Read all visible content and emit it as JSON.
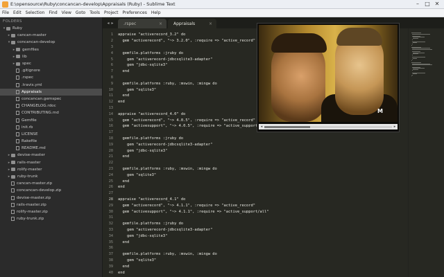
{
  "window": {
    "title": "E:\\opensource\\Ruby\\concancan-develop\\Appraisals (Ruby) - Sublime Text",
    "controls": [
      "–",
      "□",
      "✕"
    ]
  },
  "menu": [
    "File",
    "Edit",
    "Selection",
    "Find",
    "View",
    "Goto",
    "Tools",
    "Project",
    "Preferences",
    "Help"
  ],
  "sidebar": {
    "header": "FOLDERS",
    "items": [
      {
        "label": "Ruby",
        "indent": 0,
        "type": "folder",
        "expanded": true
      },
      {
        "label": "cancan-master",
        "indent": 1,
        "type": "folder",
        "expanded": false
      },
      {
        "label": "concancan-develop",
        "indent": 1,
        "type": "folder",
        "expanded": true
      },
      {
        "label": "gemfiles",
        "indent": 2,
        "type": "folder",
        "expanded": false
      },
      {
        "label": "lib",
        "indent": 2,
        "type": "folder",
        "expanded": false
      },
      {
        "label": "spec",
        "indent": 2,
        "type": "folder",
        "expanded": false
      },
      {
        "label": ".gitignore",
        "indent": 2,
        "type": "file"
      },
      {
        "label": ".rspec",
        "indent": 2,
        "type": "file"
      },
      {
        "label": ".travis.yml",
        "indent": 2,
        "type": "file"
      },
      {
        "label": "Appraisals",
        "indent": 2,
        "type": "file",
        "selected": true
      },
      {
        "label": "concancan.gemspec",
        "indent": 2,
        "type": "file"
      },
      {
        "label": "CHANGELOG.rdoc",
        "indent": 2,
        "type": "file"
      },
      {
        "label": "CONTRIBUTING.md",
        "indent": 2,
        "type": "file"
      },
      {
        "label": "Gemfile",
        "indent": 2,
        "type": "file"
      },
      {
        "label": "init.rb",
        "indent": 2,
        "type": "file"
      },
      {
        "label": "LICENSE",
        "indent": 2,
        "type": "file"
      },
      {
        "label": "Rakefile",
        "indent": 2,
        "type": "file"
      },
      {
        "label": "README.md",
        "indent": 2,
        "type": "file"
      },
      {
        "label": "devise-master",
        "indent": 1,
        "type": "folder",
        "expanded": false
      },
      {
        "label": "rails-master",
        "indent": 1,
        "type": "folder",
        "expanded": false
      },
      {
        "label": "rolify-master",
        "indent": 1,
        "type": "folder",
        "expanded": false
      },
      {
        "label": "ruby-trunk",
        "indent": 1,
        "type": "folder",
        "expanded": false
      },
      {
        "label": "cancan-master.zip",
        "indent": 1,
        "type": "file"
      },
      {
        "label": "concancan-develop.zip",
        "indent": 1,
        "type": "file"
      },
      {
        "label": "devise-master.zip",
        "indent": 1,
        "type": "file"
      },
      {
        "label": "rails-master.zip",
        "indent": 1,
        "type": "file"
      },
      {
        "label": "rolify-master.zip",
        "indent": 1,
        "type": "file"
      },
      {
        "label": "ruby-trunk.zip",
        "indent": 1,
        "type": "file"
      }
    ]
  },
  "tabs": [
    {
      "label": ".rspec",
      "active": false
    },
    {
      "label": "Appraisals",
      "active": true
    }
  ],
  "tab_close_glyph": "×",
  "editor": {
    "highlight_line": 28,
    "lines": [
      "appraise \"activerecord_3.2\" do",
      "  gem \"activerecord\", \"~> 3.2.0\", :require => \"active_record\"",
      "",
      "  gemfile.platforms :jruby do",
      "    gem \"activerecord-jdbcsqlite3-adapter\"",
      "    gem \"jdbc-sqlite3\"",
      "  end",
      "",
      "  gemfile.platforms :ruby, :mswin, :mingw do",
      "    gem \"sqlite3\"",
      "  end",
      "end",
      "",
      "appraise \"activerecord_4.0\" do",
      "  gem \"activerecord\", \"~> 4.0.5\", :require => \"active_record\"",
      "  gem \"activesupport\", \"~> 4.0.5\", :require => \"active_support/all\"",
      "",
      "  gemfile.platforms :jruby do",
      "    gem \"activerecord-jdbcsqlite3-adapter\"",
      "    gem \"jdbc-sqlite3\"",
      "  end",
      "",
      "  gemfile.platforms :ruby, :mswin, :mingw do",
      "    gem \"sqlite3\"",
      "  end",
      "end",
      "",
      "appraise \"activerecord_4.1\" do",
      "  gem \"activerecord\", \"~> 4.1.1\", :require => \"active_record\"",
      "  gem \"activesupport\", \"~> 4.1.1\", :require => \"active_support/all\"",
      "",
      "  gemfile.platforms :jruby do",
      "    gem \"activerecord-jdbcsqlite3-adapter\"",
      "    gem \"jdbc-sqlite3\"",
      "  end",
      "",
      "  gemfile.platforms :ruby, :mswin, :mingw do",
      "    gem \"sqlite3\"",
      "  end",
      "end"
    ]
  },
  "video": {
    "logo": "M",
    "progress": 0.36
  },
  "icons": {
    "app": "sublime-text-icon",
    "tab_prev": "◂",
    "tab_next": "▸",
    "chev_open": "▾",
    "chev_closed": "▸",
    "ctl_prev": "◂",
    "ctl_next": "▸"
  }
}
